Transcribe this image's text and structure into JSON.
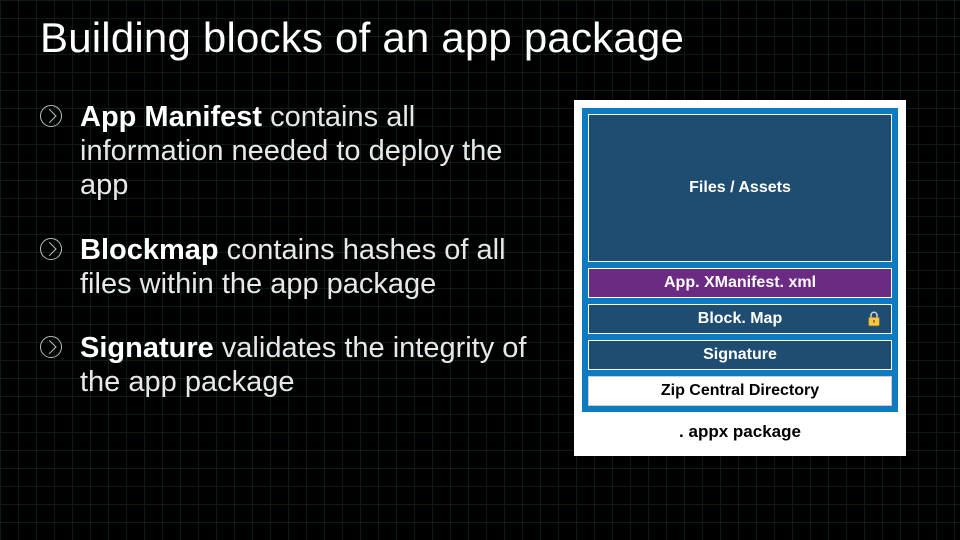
{
  "title": "Building blocks of an app package",
  "bullets": [
    {
      "bold": "App Manifest",
      "rest": " contains all information needed to deploy the app"
    },
    {
      "bold": "Blockmap",
      "rest": " contains hashes of all files within the app package"
    },
    {
      "bold": "Signature",
      "rest": " validates the integrity of the app package"
    }
  ],
  "package": {
    "files": "Files / Assets",
    "manifest": "App. XManifest. xml",
    "blockmap": "Block. Map",
    "signature": "Signature",
    "zip": "Zip Central Directory",
    "caption": ". appx package"
  }
}
